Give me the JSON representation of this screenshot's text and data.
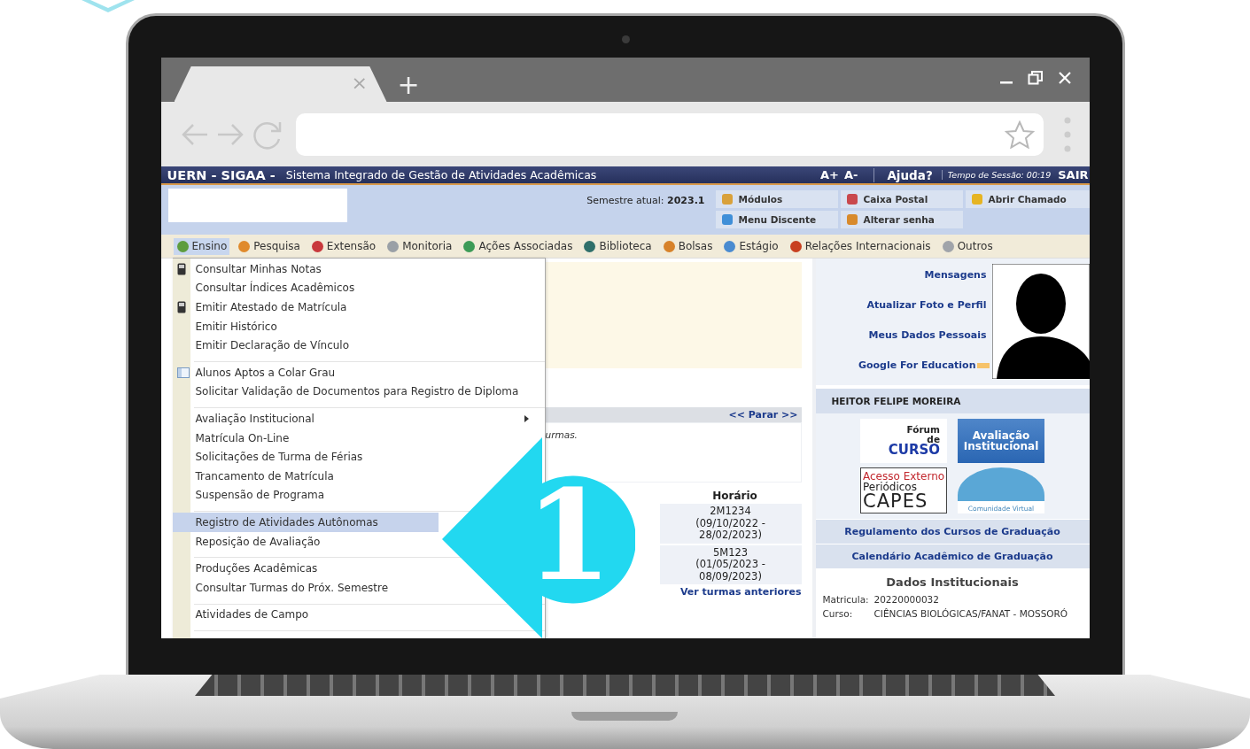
{
  "browser": {
    "tab_close": "×",
    "new_tab": "+"
  },
  "header": {
    "system": "UERN - SIGAA -",
    "subtitle": "Sistema Integrado de Gestão de Atividades Acadêmicas",
    "font_up": "A+",
    "font_down": "A-",
    "help": "Ajuda?",
    "session_label": "Tempo de Sessão:",
    "session_time": "00:19",
    "logout": "SAIR"
  },
  "info": {
    "semester_label": "Semestre atual:",
    "semester": "2023.1",
    "shortcuts": [
      {
        "label": "Módulos"
      },
      {
        "label": "Caixa Postal"
      },
      {
        "label": "Abrir Chamado"
      },
      {
        "label": "Menu Discente"
      },
      {
        "label": "Alterar senha"
      }
    ]
  },
  "menu": [
    {
      "label": "Ensino",
      "selected": true
    },
    {
      "label": "Pesquisa",
      "selected": false
    },
    {
      "label": "Extensão",
      "selected": false
    },
    {
      "label": "Monitoria",
      "selected": false
    },
    {
      "label": "Ações Associadas",
      "selected": false
    },
    {
      "label": "Biblioteca",
      "selected": false
    },
    {
      "label": "Bolsas",
      "selected": false
    },
    {
      "label": "Estágio",
      "selected": false
    },
    {
      "label": "Relações Internacionais",
      "selected": false
    },
    {
      "label": "Outros",
      "selected": false
    }
  ],
  "dropdown": [
    [
      {
        "kind": "device",
        "label": "Consultar Minhas Notas",
        "submenu": false,
        "selected": false
      },
      {
        "kind": "plain",
        "label": "Consultar Índices Acadêmicos",
        "submenu": false,
        "selected": false
      },
      {
        "kind": "device",
        "label": "Emitir Atestado de Matrícula",
        "submenu": false,
        "selected": false
      },
      {
        "kind": "plain",
        "label": "Emitir Histórico",
        "submenu": false,
        "selected": false
      },
      {
        "kind": "plain",
        "label": "Emitir Declaração de Vínculo",
        "submenu": false,
        "selected": false
      }
    ],
    [
      {
        "kind": "page",
        "label": "Alunos Aptos a Colar Grau",
        "submenu": false,
        "selected": false
      },
      {
        "kind": "plain",
        "label": "Solicitar Validação de Documentos para Registro de Diploma",
        "submenu": false,
        "selected": false
      }
    ],
    [
      {
        "kind": "plain",
        "label": "Avaliação Institucional",
        "submenu": true,
        "selected": false
      },
      {
        "kind": "plain",
        "label": "Matrícula On-Line",
        "submenu": false,
        "selected": false
      },
      {
        "kind": "plain",
        "label": "Solicitações de Turma de Férias",
        "submenu": false,
        "selected": false
      },
      {
        "kind": "plain",
        "label": "Trancamento de Matrícula",
        "submenu": false,
        "selected": false
      },
      {
        "kind": "plain",
        "label": "Suspensão de Programa",
        "submenu": false,
        "selected": false
      }
    ],
    [
      {
        "kind": "plain",
        "label": "Registro de Atividades Autônomas",
        "submenu": false,
        "selected": true
      },
      {
        "kind": "plain",
        "label": "Reposição de Avaliação",
        "submenu": false,
        "selected": false
      }
    ],
    [
      {
        "kind": "plain",
        "label": "Produções Acadêmicas",
        "submenu": false,
        "selected": false
      },
      {
        "kind": "plain",
        "label": "Consultar Turmas do Próx. Semestre",
        "submenu": false,
        "selected": false
      }
    ],
    [
      {
        "kind": "plain",
        "label": "Atividades de Campo",
        "submenu": false,
        "selected": false
      }
    ]
  ],
  "classes": {
    "notice": "urmas.",
    "stop_link": "<< Parar >>",
    "schedule_heading": "Horário",
    "schedules": [
      [
        "2M1234",
        "(09/10/2022 -",
        "28/02/2023)"
      ],
      [
        "5M123",
        "(01/05/2023 -",
        "08/09/2023)"
      ]
    ],
    "more_link": "Ver turmas anteriores"
  },
  "profile": {
    "links": [
      "Mensagens",
      "Atualizar Foto e Perfil",
      "Meus Dados Pessoais",
      "Google For Education"
    ],
    "name": "HEITOR FELIPE MOREIRA",
    "banners": [
      {
        "kind": "forum",
        "lines": [
          "Fórum",
          "de",
          "CURSO"
        ]
      },
      {
        "kind": "evaluation",
        "lines": [
          "Avaliação",
          "Institucional"
        ]
      },
      {
        "kind": "capes",
        "lines": [
          "Acesso Externo",
          "Periódicos",
          "CAPES"
        ]
      },
      {
        "kind": "community",
        "lines": [
          "Comunidade Virtual"
        ]
      }
    ],
    "links2": [
      "Regulamento dos Cursos de Graduação",
      "Calendário Acadêmico de Graduação"
    ],
    "section_title": "Dados Institucionais",
    "fields": [
      {
        "label": "Matricula:",
        "value": "20220000032"
      },
      {
        "label": "Curso:",
        "value": "CIÊNCIAS BIOLÓGICAS/FANAT - MOSSORÓ"
      }
    ]
  },
  "callout": {
    "label": "1"
  }
}
